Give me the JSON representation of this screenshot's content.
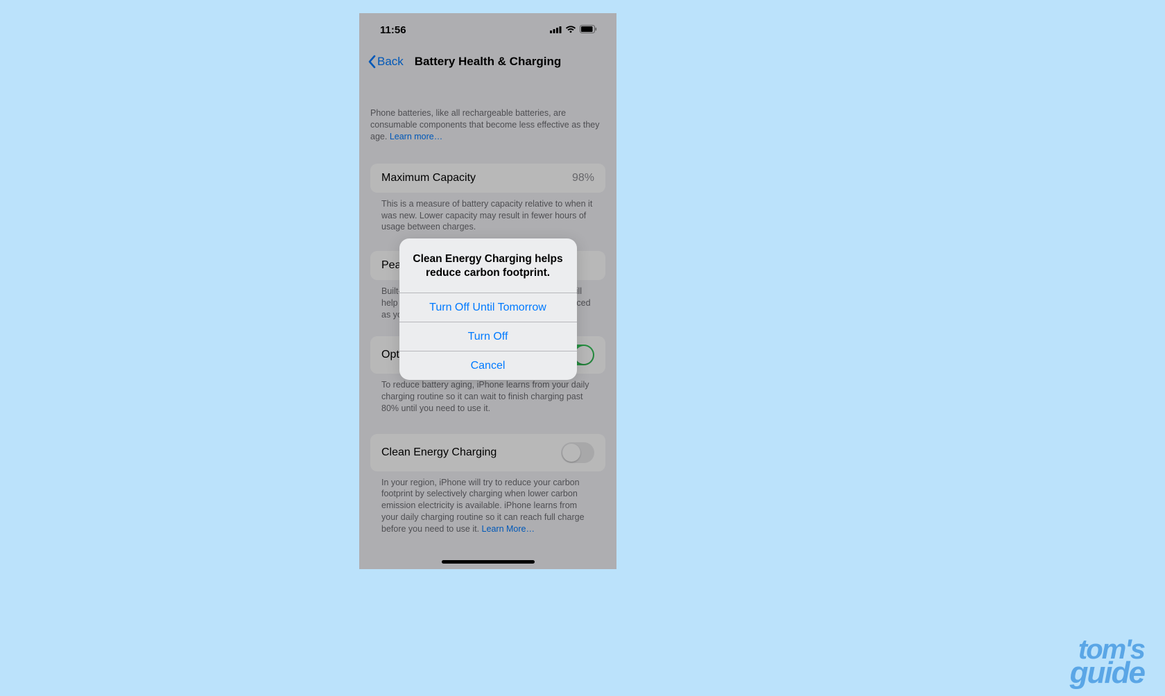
{
  "statusBar": {
    "time": "11:56"
  },
  "nav": {
    "back": "Back",
    "title": "Battery Health & Charging"
  },
  "intro": {
    "text": "Phone batteries, like all rechargeable batteries, are consumable components that become less effective as they age. ",
    "link": "Learn more…"
  },
  "maxCapacity": {
    "label": "Maximum Capacity",
    "value": "98%",
    "footer": "This is a measure of battery capacity relative to when it was new. Lower capacity may result in fewer hours of usage between charges."
  },
  "peak": {
    "label": "Peak Performance Capability",
    "footer": "Built-in dynamic software and hardware systems will help counter performance impacts that may be noticed as your iPhone battery chemically ages."
  },
  "optimized": {
    "label": "Optimized Battery Charging",
    "on": true,
    "footer": "To reduce battery aging, iPhone learns from your daily charging routine so it can wait to finish charging past 80% until you need to use it."
  },
  "clean": {
    "label": "Clean Energy Charging",
    "on": false,
    "footer": "In your region, iPhone will try to reduce your carbon footprint by selectively charging when lower carbon emission electricity is available. iPhone learns from your daily charging routine so it can reach full charge before you need to use it. ",
    "link": "Learn More…"
  },
  "alert": {
    "title": "Clean Energy Charging helps reduce carbon footprint.",
    "untilTomorrow": "Turn Off Until Tomorrow",
    "turnOff": "Turn Off",
    "cancel": "Cancel"
  },
  "watermark": {
    "line1": "tom's",
    "line2": "guide"
  }
}
